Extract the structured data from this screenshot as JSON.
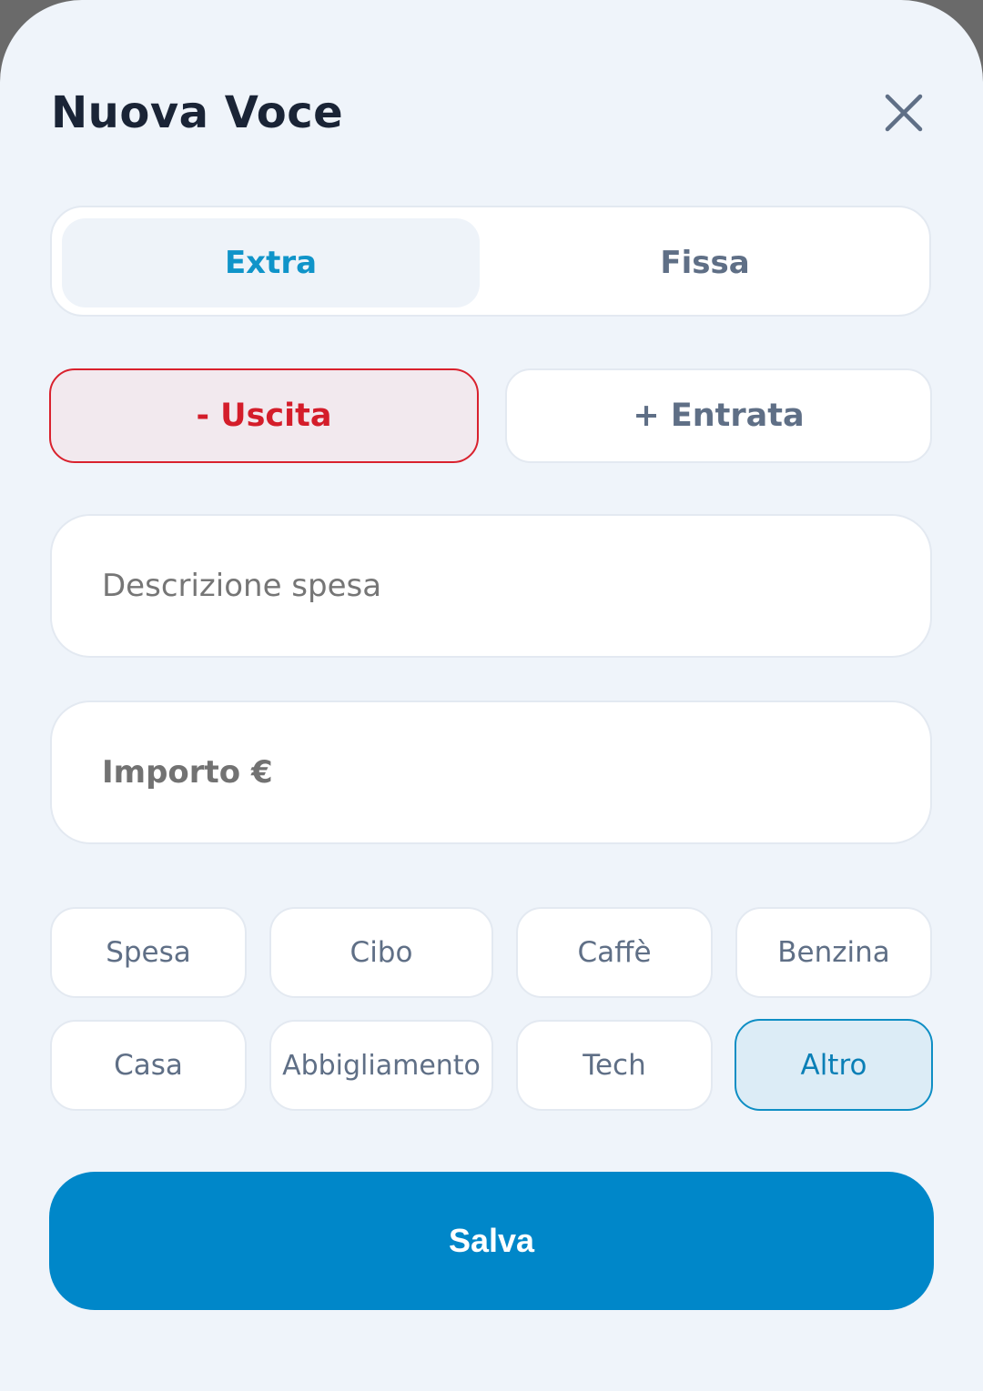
{
  "dialog": {
    "title": "Nuova Voce",
    "close_icon": "close-icon"
  },
  "frequency": {
    "options": [
      "Extra",
      "Fissa"
    ],
    "selected": "Extra"
  },
  "type": {
    "uscita_label": "- Uscita",
    "entrata_label": "+ Entrata",
    "selected": "Uscita"
  },
  "fields": {
    "description_placeholder": "Descrizione spesa",
    "amount_placeholder": "Importo €",
    "description_value": "",
    "amount_value": ""
  },
  "categories": {
    "items": [
      "Spesa",
      "Cibo",
      "Caffè",
      "Benzina",
      "Casa",
      "Abbigliamento",
      "Tech",
      "Altro"
    ],
    "selected": "Altro"
  },
  "actions": {
    "save_label": "Salva"
  },
  "colors": {
    "background": "#eff4fa",
    "accent": "#0087c9",
    "expense": "#d41d2a",
    "text_dark": "#1a2436",
    "text_muted": "#5f6f86"
  }
}
